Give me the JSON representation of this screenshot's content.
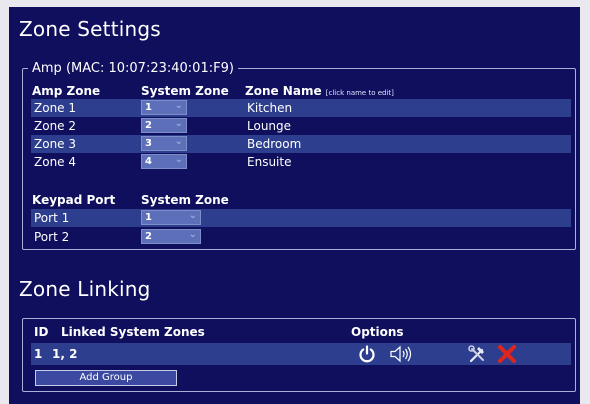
{
  "zone_settings": {
    "title": "Zone Settings",
    "amp_legend": "Amp (MAC: 10:07:23:40:01:F9)",
    "headers": {
      "amp_zone": "Amp Zone",
      "system_zone": "System Zone",
      "zone_name": "Zone Name",
      "zone_name_note": "[click name to edit]"
    },
    "zones": [
      {
        "amp_zone": "Zone 1",
        "system_zone": "1",
        "zone_name": "Kitchen"
      },
      {
        "amp_zone": "Zone 2",
        "system_zone": "2",
        "zone_name": "Lounge"
      },
      {
        "amp_zone": "Zone 3",
        "system_zone": "3",
        "zone_name": "Bedroom"
      },
      {
        "amp_zone": "Zone 4",
        "system_zone": "4",
        "zone_name": "Ensuite"
      }
    ],
    "keypad_headers": {
      "port": "Keypad Port",
      "system_zone": "System Zone"
    },
    "ports": [
      {
        "port": "Port 1",
        "system_zone": "1"
      },
      {
        "port": "Port 2",
        "system_zone": "2"
      }
    ]
  },
  "zone_linking": {
    "title": "Zone Linking",
    "headers": {
      "id": "ID",
      "linked": "Linked System Zones",
      "options": "Options"
    },
    "groups": [
      {
        "id": "1",
        "linked": "1, 2"
      }
    ],
    "add_group_label": "Add Group"
  },
  "colors": {
    "background": "#0f0f5e",
    "stripe": "#2e3e8f",
    "delete_red": "#e0251c"
  },
  "icons": [
    "chevron-down-icon",
    "power-icon",
    "speaker-icon",
    "tools-icon",
    "delete-icon"
  ]
}
